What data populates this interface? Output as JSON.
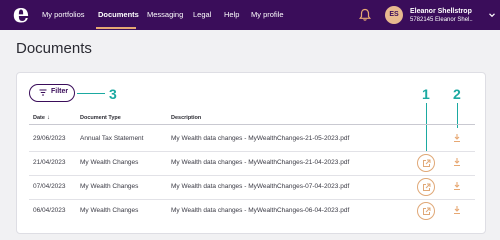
{
  "nav": {
    "logo": "e",
    "items": [
      "My portfolios",
      "Documents",
      "Messaging",
      "Legal",
      "Help",
      "My profile"
    ],
    "active_index": 1
  },
  "user": {
    "initials": "ES",
    "name": "Eleanor Shellstrop",
    "account": "5782145 Eleanor Shel.."
  },
  "page": {
    "title": "Documents"
  },
  "filter": {
    "label": "Filter"
  },
  "callouts": [
    "1",
    "2",
    "3"
  ],
  "table": {
    "columns": [
      "Date",
      "Document Type",
      "Description"
    ],
    "rows": [
      {
        "date": "29/06/2023",
        "type": "Annual Tax Statement",
        "description": "My Wealth data changes - MyWealthChanges-21-05-2023.pdf"
      },
      {
        "date": "21/04/2023",
        "type": "My Wealth Changes",
        "description": "My Wealth data changes - MyWealthChanges-21-04-2023.pdf"
      },
      {
        "date": "07/04/2023",
        "type": "My Wealth Changes",
        "description": "My Wealth data changes - MyWealthChanges-07-04-2023.pdf"
      },
      {
        "date": "06/04/2023",
        "type": "My Wealth Changes",
        "description": "My Wealth data changes - MyWealthChanges-06-04-2023.pdf"
      }
    ]
  },
  "colors": {
    "nav_bg": "#3a0d5a",
    "accent": "#e7a873",
    "callout": "#1ba9a1"
  },
  "icons": [
    "bell-icon",
    "chevron-down-icon",
    "filter-icon",
    "open-external-icon",
    "download-icon"
  ]
}
